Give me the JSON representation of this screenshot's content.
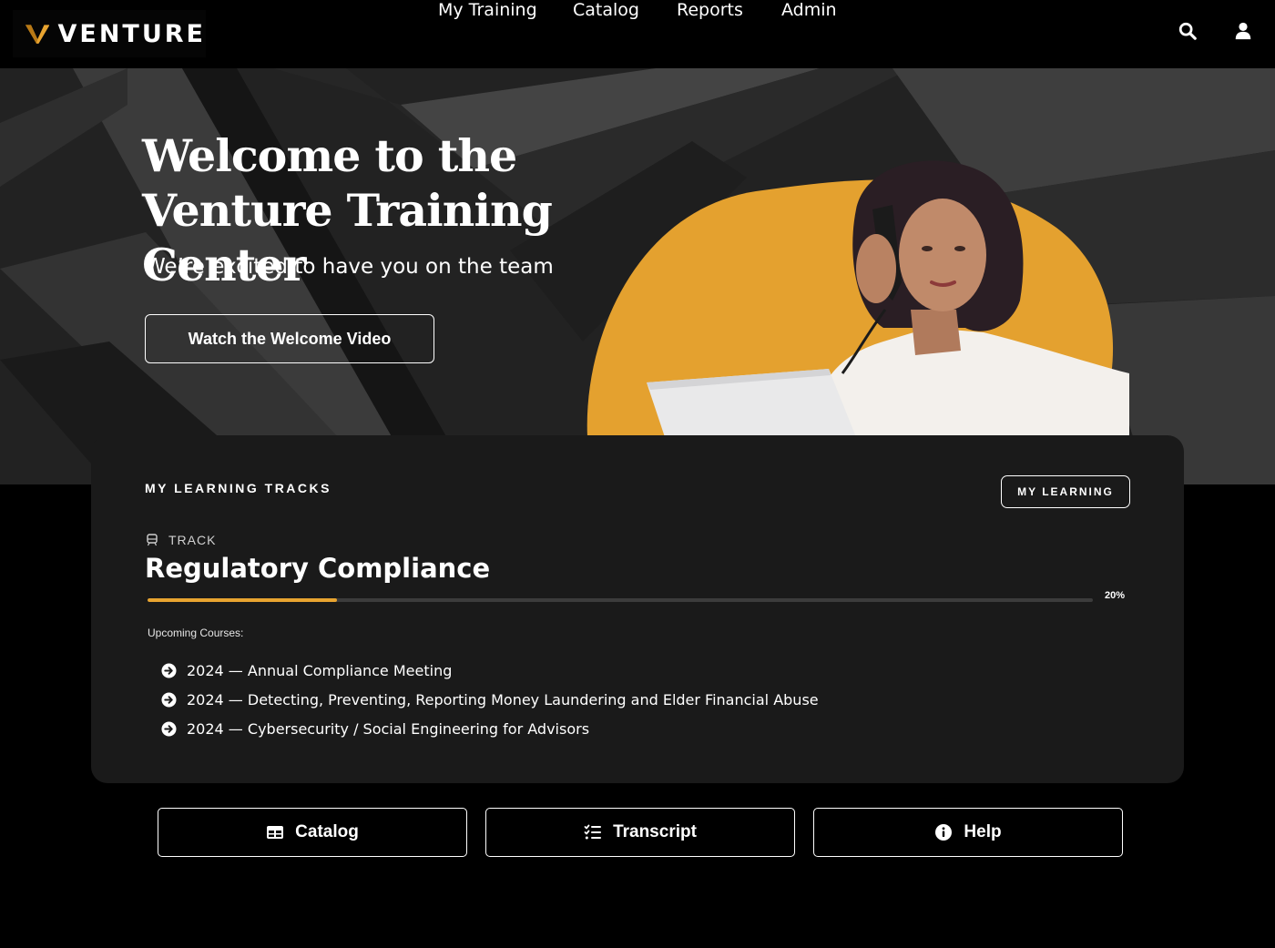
{
  "brand": {
    "name": "VENTURE",
    "accent": "#e8a430"
  },
  "nav": {
    "items": [
      {
        "label": "My Training"
      },
      {
        "label": "Catalog"
      },
      {
        "label": "Reports"
      },
      {
        "label": "Admin"
      }
    ],
    "icons": [
      "search-icon",
      "user-icon"
    ]
  },
  "hero": {
    "title": "Welcome to the Venture Training Center",
    "subtitle": "We’re excited to have you on the team",
    "button_label": "Watch the Welcome Video"
  },
  "tracks": {
    "heading": "MY LEARNING TRACKS",
    "my_learning_label": "MY LEARNING",
    "track_label": "TRACK",
    "track_title": "Regulatory Compliance",
    "progress_percent": 20,
    "progress_text": "20%",
    "upcoming_label": "Upcoming Courses:",
    "courses": [
      "2024 — Annual Compliance Meeting",
      "2024 — Detecting, Preventing, Reporting Money Laundering and Elder Financial Abuse",
      "2024 — Cybersecurity / Social Engineering for Advisors"
    ]
  },
  "actions": {
    "catalog_label": "Catalog",
    "transcript_label": "Transcript",
    "help_label": "Help"
  }
}
